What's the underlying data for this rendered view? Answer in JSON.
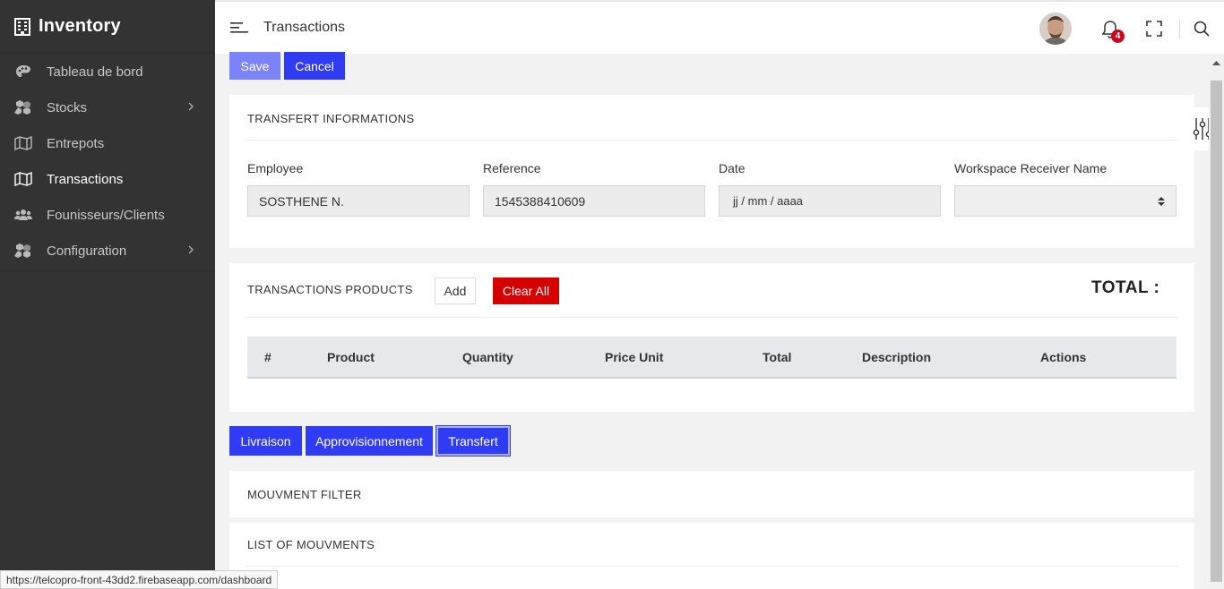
{
  "sidebar": {
    "brand": "Inventory",
    "items": [
      {
        "label": "Tableau de bord",
        "icon": "palette-icon"
      },
      {
        "label": "Stocks",
        "icon": "boxes-icon"
      },
      {
        "label": "Entrepots",
        "icon": "map-icon"
      },
      {
        "label": "Transactions",
        "icon": "map-icon"
      },
      {
        "label": "Founisseurs/Clients",
        "icon": "users-icon"
      },
      {
        "label": "Configuration",
        "icon": "boxes-icon"
      }
    ]
  },
  "topbar": {
    "title": "Transactions",
    "notification_count": "4"
  },
  "actions": {
    "save": "Save",
    "cancel": "Cancel"
  },
  "transfer_info": {
    "title": "TRANSFERT INFORMATIONS",
    "fields": [
      {
        "label": "Employee",
        "value": "SOSTHENE N."
      },
      {
        "label": "Reference",
        "value": "1545388410609"
      },
      {
        "label": "Date",
        "value": "jj / mm / aaaa"
      },
      {
        "label": "Workspace Receiver Name",
        "value": ""
      }
    ]
  },
  "products": {
    "title": "TRANSACTIONS PRODUCTS",
    "add": "Add",
    "clear_all": "Clear All",
    "total_label": "TOTAL :",
    "columns": [
      "#",
      "Product",
      "Quantity",
      "Price Unit",
      "Total",
      "Description",
      "Actions"
    ]
  },
  "tabs": [
    "Livraison",
    "Approvisionnement",
    "Transfert"
  ],
  "mouvement_filter": {
    "title": "MOUVMENT FILTER"
  },
  "list_mouvments": {
    "title": "LIST OF MOUVMENTS"
  },
  "status_url": "https://telcopro-front-43dd2.firebaseapp.com/dashboard",
  "colors": {
    "primary": "#2f3cf4",
    "primary_light": "#7c83fa",
    "danger": "#d60000",
    "sidebar_bg": "#333333"
  }
}
